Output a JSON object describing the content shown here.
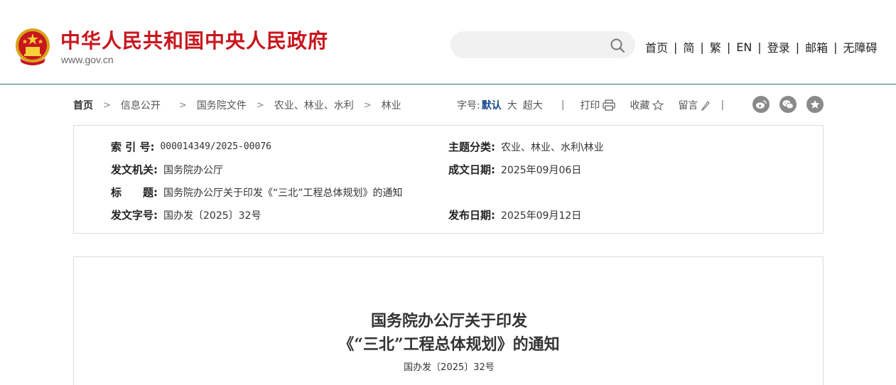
{
  "header": {
    "site_title": "中华人民共和国中央人民政府",
    "site_url": "www.gov.cn",
    "search_placeholder": "",
    "nav": [
      "首页",
      "简",
      "繁",
      "EN",
      "登录",
      "邮箱",
      "无障碍"
    ],
    "nav_separator": "|"
  },
  "breadcrumb": {
    "items": [
      "首页",
      "信息公开",
      "国务院文件",
      "农业、林业、水利",
      "林业"
    ],
    "separator": ">"
  },
  "toolbar": {
    "font_size_label": "字号:",
    "font_size_default": "默认",
    "font_size_large": "大",
    "font_size_xlarge": "超大",
    "divider": "|",
    "print_label": "打印",
    "favorite_label": "收藏",
    "comment_label": "留言"
  },
  "info": {
    "index_label": "索 引 号:",
    "index_value": "000014349/2025-00076",
    "category_label": "主题分类:",
    "category_value": "农业、林业、水利\\林业",
    "issuer_label": "发文机关:",
    "issuer_value": "国务院办公厅",
    "written_date_label": "成文日期:",
    "written_date_value": "2025年09月06日",
    "title_label": "标　　题:",
    "title_value": "国务院办公厅关于印发《“三北”工程总体规划》的通知",
    "doc_no_label": "发文字号:",
    "doc_no_value": "国办发〔2025〕32号",
    "publish_date_label": "发布日期:",
    "publish_date_value": "2025年09月12日"
  },
  "document": {
    "title_line1": "国务院办公厅关于印发",
    "title_line2": "《“三北”工程总体规划》的通知",
    "number": "国办发〔2025〕32号"
  },
  "colors": {
    "brand_red": "#c8161d",
    "accent_blue": "#1a4a8c",
    "header_line": "#3a6a88"
  },
  "icons": [
    "national-emblem",
    "search-icon",
    "printer-icon",
    "star-icon",
    "pencil-icon",
    "weibo-icon",
    "wechat-icon",
    "favorite-star-icon"
  ]
}
